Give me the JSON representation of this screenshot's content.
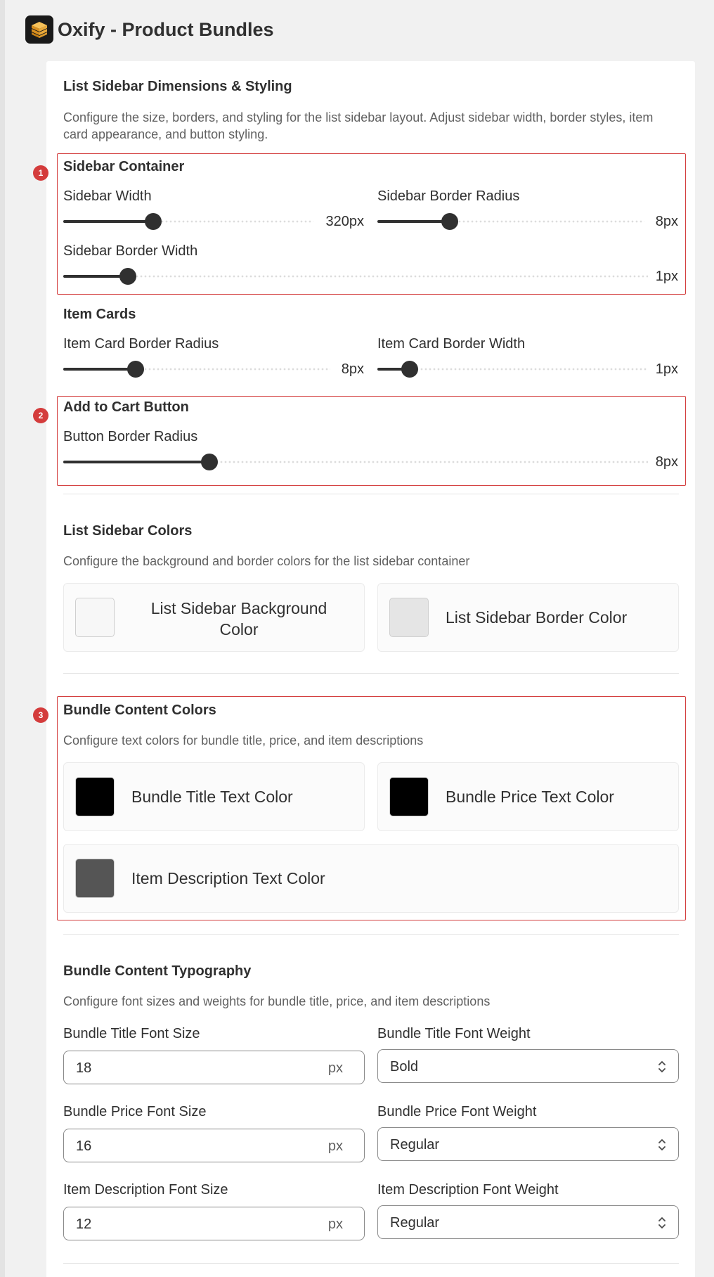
{
  "app": {
    "title": "Oxify - Product Bundles",
    "logo_icon": "stacked-boxes-icon"
  },
  "dimensions": {
    "title": "List Sidebar Dimensions & Styling",
    "description": "Configure the size, borders, and styling for the list sidebar layout. Adjust sidebar width, border styles, item card appearance, and button styling.",
    "sidebar_container": {
      "badge": "1",
      "title": "Sidebar Container",
      "sidebar_width": {
        "label": "Sidebar Width",
        "value": "320px",
        "fraction": 0.36
      },
      "sidebar_border_radius": {
        "label": "Sidebar Border Radius",
        "value": "8px",
        "fraction": 0.27
      },
      "sidebar_border_width": {
        "label": "Sidebar Border Width",
        "value": "1px",
        "fraction": 0.11
      }
    },
    "item_cards": {
      "title": "Item Cards",
      "item_card_border_radius": {
        "label": "Item Card Border Radius",
        "value": "8px",
        "fraction": 0.27
      },
      "item_card_border_width": {
        "label": "Item Card Border Width",
        "value": "1px",
        "fraction": 0.12
      }
    },
    "add_to_cart": {
      "badge": "2",
      "title": "Add to Cart Button",
      "button_border_radius": {
        "label": "Button Border Radius",
        "value": "8px",
        "fraction": 0.25
      }
    }
  },
  "sidebar_colors": {
    "title": "List Sidebar Colors",
    "description": "Configure the background and border colors for the list sidebar container",
    "background": {
      "label": "List Sidebar Background Color",
      "color": "#f7f7f7"
    },
    "border": {
      "label": "List Sidebar Border Color",
      "color": "#e5e5e5"
    }
  },
  "content_colors": {
    "badge": "3",
    "title": "Bundle Content Colors",
    "description": "Configure text colors for bundle title, price, and item descriptions",
    "title_text": {
      "label": "Bundle Title Text Color",
      "color": "#000000"
    },
    "price_text": {
      "label": "Bundle Price Text Color",
      "color": "#000000"
    },
    "item_description_text": {
      "label": "Item Description Text Color",
      "color": "#555555"
    }
  },
  "typography": {
    "title": "Bundle Content Typography",
    "description": "Configure font sizes and weights for bundle title, price, and item descriptions",
    "title_size": {
      "label": "Bundle Title Font Size",
      "value": "18",
      "suffix": "px"
    },
    "title_weight": {
      "label": "Bundle Title Font Weight",
      "value": "Bold"
    },
    "price_size": {
      "label": "Bundle Price Font Size",
      "value": "16",
      "suffix": "px"
    },
    "price_weight": {
      "label": "Bundle Price Font Weight",
      "value": "Regular"
    },
    "desc_size": {
      "label": "Item Description Font Size",
      "value": "12",
      "suffix": "px"
    },
    "desc_weight": {
      "label": "Item Description Font Weight",
      "value": "Regular"
    }
  }
}
